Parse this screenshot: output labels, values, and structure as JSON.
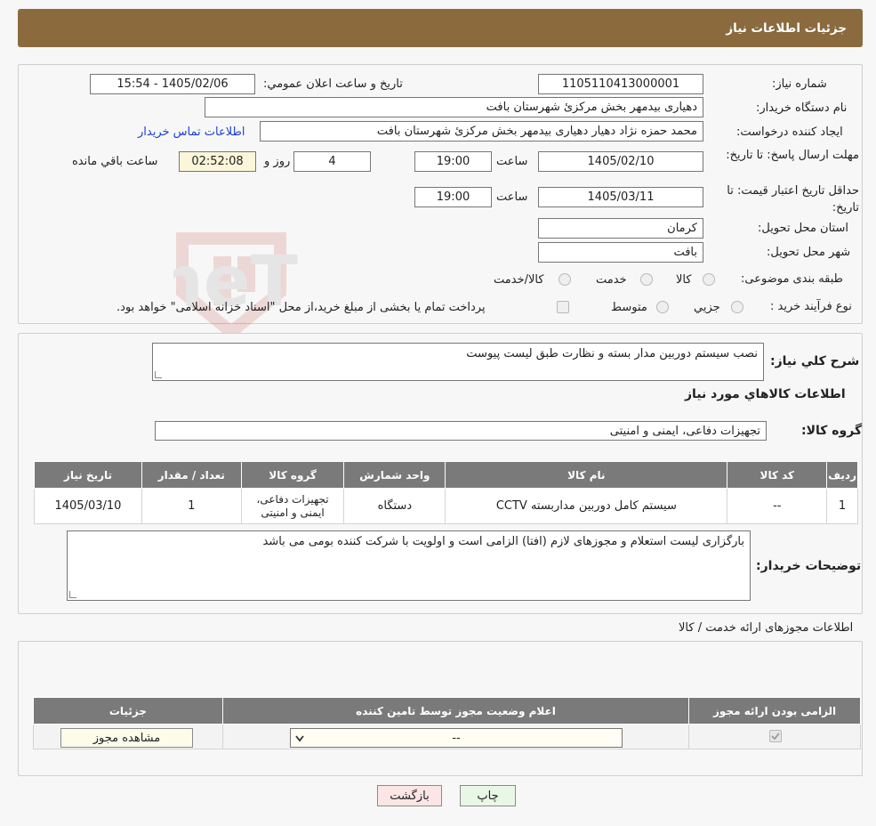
{
  "header": {
    "title": "جزئیات اطلاعات نیاز"
  },
  "info": {
    "need_number_label": "شماره نیاز:",
    "need_number": "1105110413000001",
    "announce_label": "تاریخ و ساعت اعلان عمومي:",
    "announce_value": "1405/02/06 - 15:54",
    "buyer_org_label": "نام دستگاه خريدار:",
    "buyer_org": "دهیاری بیدمهر بخش مرکزئ شهرستان بافت",
    "requester_label": "ايجاد کننده درخواست:",
    "requester": "محمد حمزه نژاد دهیار دهیاری بیدمهر بخش مرکزئ شهرستان بافت",
    "contact_link": "اطلاعات تماس خريدار",
    "deadline_label": "مهلت ارسال پاسخ: تا تاریخ:",
    "deadline_date": "1405/02/10",
    "time_label": "ساعت",
    "deadline_time": "19:00",
    "days": "4",
    "days_label": "روز و",
    "remaining": "02:52:08",
    "remaining_label": "ساعت باقي مانده",
    "validity_label": "حداقل تاريخ اعتبار قيمت: تا تاریخ:",
    "validity_date": "1405/03/11",
    "validity_time": "19:00",
    "province_label": "استان محل تحويل:",
    "province": "کرمان",
    "city_label": "شهر محل تحويل:",
    "city": "بافت",
    "category_label": "طبقه بندی موضوعی:",
    "category_options": [
      "کالا",
      "خدمت",
      "کالا/خدمت"
    ],
    "process_label": "نوع فرآيند خريد :",
    "process_options": [
      "جزيي",
      "متوسط"
    ],
    "process_note": "پرداخت تمام یا بخشی از مبلغ خرید،از محل \"اسناد خزانه اسلامی\" خواهد بود."
  },
  "details": {
    "summary_label": "شرح کلي نياز:",
    "summary": "نصب سیستم دوربین مدار بسته و نظارت طبق لیست پیوست",
    "goods_heading": "اطلاعات کالاهاي مورد نياز",
    "group_label": "گروه کالا:",
    "group_value": "تجهیزات دفاعی، ایمنی و امنیتی",
    "table_headers": [
      "رديف",
      "کد کالا",
      "نام کالا",
      "واحد شمارش",
      "گروه کالا",
      "تعداد / مقدار",
      "تاريخ نياز"
    ],
    "rows": [
      {
        "row": "1",
        "code": "--",
        "name": "سیستم کامل دوربین مداربسته CCTV",
        "unit": "دستگاه",
        "group": "تجهيزات دفاعی، ايمنی و امنيتی",
        "qty": "1",
        "date": "1405/03/10"
      }
    ],
    "buyer_notes_label": "توضيحات خريدار:",
    "buyer_notes": "بارگزاری لیست استعلام و مجوزهای لازم (افتا) الزامی است و اولویت با شرکت کننده بومی می باشد"
  },
  "permits": {
    "heading": "اطلاعات مجوزهای ارائه خدمت / کالا",
    "table_headers": [
      "الزامی بودن ارائه مجوز",
      "اعلام وضعیت مجوز توسط تامین کننده",
      "جزئیات"
    ],
    "select_value": "--",
    "view_button": "مشاهده مجوز"
  },
  "footer": {
    "print_button": "چاپ",
    "back_button": "بازگشت"
  },
  "watermark_text": "AriaTender.neT"
}
